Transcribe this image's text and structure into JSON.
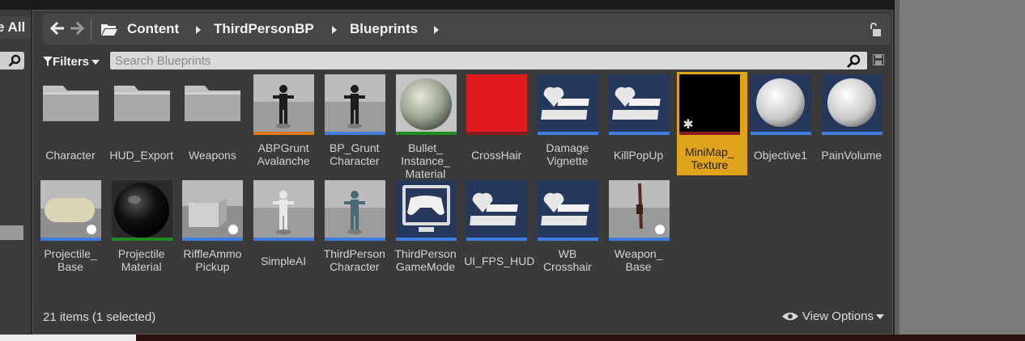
{
  "toolbar": {
    "save_all_label": "e All"
  },
  "breadcrumb": {
    "items": [
      "Content",
      "ThirdPersonBP",
      "Blueprints"
    ]
  },
  "search": {
    "placeholder": "Search Blueprints",
    "value": ""
  },
  "filters": {
    "label": "Filters"
  },
  "assets": [
    {
      "name": "Character",
      "type": "folder"
    },
    {
      "name": "HUD_Export",
      "type": "folder"
    },
    {
      "name": "Weapons",
      "type": "folder"
    },
    {
      "name": "ABPGrunt\nAvalanche",
      "type": "animation-blueprint",
      "stripe": "#e07a10"
    },
    {
      "name": "BP_Grunt\nCharacter",
      "type": "blueprint",
      "stripe": "#3f7de0"
    },
    {
      "name": "Bullet_\nInstance_\nMaterial",
      "type": "material-instance",
      "stripe": "#1e8c1e"
    },
    {
      "name": "CrossHair",
      "type": "texture",
      "stripe": "#8b1c1c"
    },
    {
      "name": "Damage\nVignette",
      "type": "widget-blueprint",
      "stripe": "#3f7de0"
    },
    {
      "name": "KillPopUp",
      "type": "widget-blueprint",
      "stripe": "#3f7de0"
    },
    {
      "name": "MiniMap_\nTexture",
      "type": "render-target",
      "stripe": "#8b1c1c",
      "selected": true
    },
    {
      "name": "Objective1",
      "type": "blueprint",
      "stripe": "#3f7de0"
    },
    {
      "name": "PainVolume",
      "type": "blueprint",
      "stripe": "#3f7de0"
    },
    {
      "name": "Projectile_\nBase",
      "type": "blueprint",
      "stripe": "#3f7de0"
    },
    {
      "name": "Projectile\nMaterial",
      "type": "material",
      "stripe": "#1e8c1e"
    },
    {
      "name": "RiffleAmmo\nPickup",
      "type": "blueprint",
      "stripe": "#3f7de0"
    },
    {
      "name": "SimpleAI",
      "type": "blueprint",
      "stripe": "#3f7de0"
    },
    {
      "name": "ThirdPerson\nCharacter",
      "type": "blueprint",
      "stripe": "#3f7de0"
    },
    {
      "name": "ThirdPerson\nGameMode",
      "type": "blueprint",
      "stripe": "#3f7de0"
    },
    {
      "name": "UI_FPS_HUD",
      "type": "widget-blueprint",
      "stripe": "#3f7de0"
    },
    {
      "name": "WB\nCrosshair",
      "type": "widget-blueprint",
      "stripe": "#3f7de0"
    },
    {
      "name": "Weapon_\nBase",
      "type": "blueprint",
      "stripe": "#3f7de0"
    }
  ],
  "status": {
    "text": "21 items (1 selected)"
  },
  "view_options": {
    "label": "View Options"
  },
  "colors": {
    "selection": "#e0a41c",
    "blueprint_stripe": "#3f7de0",
    "material_stripe": "#1e8c1e",
    "texture_stripe": "#8b1c1c",
    "anim_stripe": "#e07a10"
  }
}
